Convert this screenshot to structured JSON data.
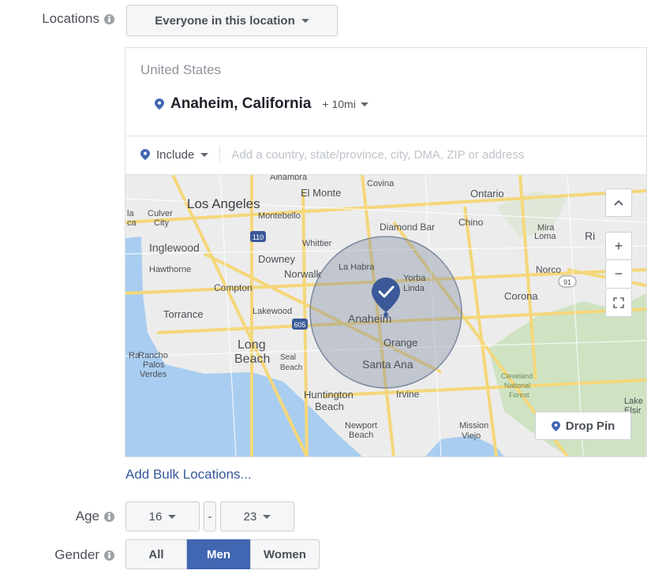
{
  "locations": {
    "label": "Locations",
    "scope_dropdown": "Everyone in this location",
    "country": "United States",
    "selected_location": "Anaheim, California",
    "radius": "+ 10mi",
    "include_dropdown": "Include",
    "search_placeholder": "Add a country, state/province, city, DMA, ZIP or address",
    "add_bulk_link": "Add Bulk Locations..."
  },
  "map": {
    "place_labels": {
      "los_angeles": "Los Angeles",
      "el_monte": "El Monte",
      "covina": "Covina",
      "ontario": "Ontario",
      "alhambra": "Alhambra",
      "culver_city_1": "Culver",
      "culver_city_2": "City",
      "montebello": "Montebello",
      "diamond_bar": "Diamond Bar",
      "chino": "Chino",
      "mira_loma_1": "Mira",
      "mira_loma_2": "Loma",
      "riverside": "Ri",
      "whittier": "Whittier",
      "inglewood": "Inglewood",
      "downey": "Downey",
      "la_habra": "La Habra",
      "norco": "Norco",
      "hawthorne": "Hawthorne",
      "norwalk": "Norwalk",
      "yorba_linda_1": "Yorba",
      "yorba_linda_2": "Linda",
      "compton": "Compton",
      "corona": "Corona",
      "torrance": "Torrance",
      "lakewood": "Lakewood",
      "anaheim": "Anaheim",
      "orange": "Orange",
      "long_beach_1": "Long",
      "long_beach_2": "Beach",
      "seal_beach_1": "Seal",
      "seal_beach_2": "Beach",
      "santa_ana": "Santa Ana",
      "rancho_palos_verdes_1": "Rancho",
      "rancho_palos_verdes_2": "Palos",
      "rancho_palos_verdes_3": "Verdes",
      "huntington_beach_1": "Huntington",
      "huntington_beach_2": "Beach",
      "irvine": "Irvine",
      "cleveland_nf_1": "Cleveland",
      "cleveland_nf_2": "National",
      "cleveland_nf_3": "Forest",
      "newport_beach_1": "Newport",
      "newport_beach_2": "Beach",
      "mission_viejo_1": "Mission",
      "mission_viejo_2": "Viejo",
      "lake_1": "Lake",
      "lake_2": "Elsir",
      "ca_edge": "ca",
      "la_edge": "la",
      "rc_edge": "Ra"
    },
    "shields": {
      "i110": "110",
      "i605": "605",
      "r91": "91"
    },
    "controls": {
      "collapse": "collapse",
      "zoom_in": "+",
      "zoom_out": "−",
      "fullscreen": "fullscreen"
    },
    "drop_pin_label": "Drop Pin",
    "colors": {
      "water": "#a9cdf0",
      "land": "#ececec",
      "park": "#cfe3c3",
      "road": "#f5d77a",
      "radius_fill": "#7c8aa0",
      "pin": "#3b5998"
    }
  },
  "age": {
    "label": "Age",
    "min": "16",
    "separator": "-",
    "max": "23"
  },
  "gender": {
    "label": "Gender",
    "options": [
      "All",
      "Men",
      "Women"
    ],
    "selected": "Men"
  },
  "colors": {
    "accent": "#4267b2",
    "link": "#365899"
  }
}
